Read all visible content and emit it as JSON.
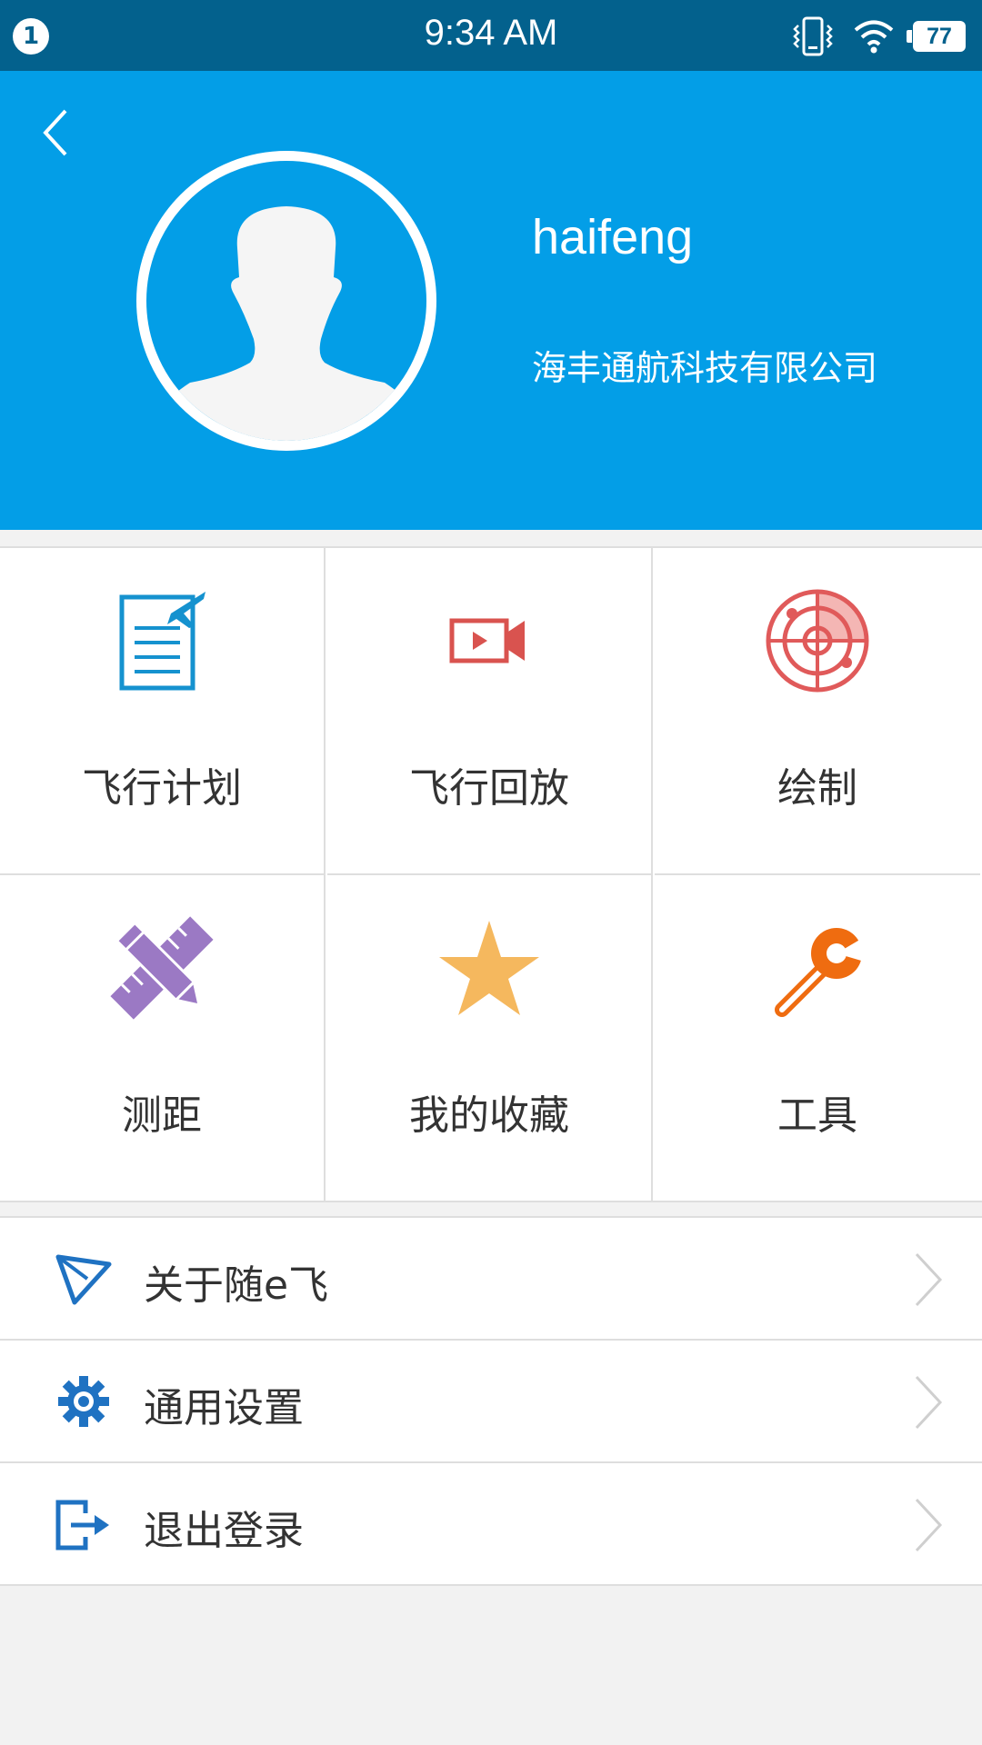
{
  "status_bar": {
    "notification_count": "1",
    "time": "9:34 AM",
    "battery": "77",
    "icons": [
      "vibrate-icon",
      "wifi-icon",
      "battery-icon"
    ]
  },
  "header": {
    "background_color": "#039ee7",
    "back_icon": "chevron-left-icon",
    "username": "haifeng",
    "company": "海丰通航科技有限公司"
  },
  "grid": {
    "items": [
      {
        "label": "飞行计划",
        "icon": "flight-plan-icon",
        "color": "#1592cf"
      },
      {
        "label": "飞行回放",
        "icon": "video-replay-icon",
        "color": "#d9534f"
      },
      {
        "label": "绘制",
        "icon": "radar-icon",
        "color": "#e05a5a"
      },
      {
        "label": "测距",
        "icon": "ruler-pencil-icon",
        "color": "#9b79c4"
      },
      {
        "label": "我的收藏",
        "icon": "star-icon",
        "color": "#f5b85e"
      },
      {
        "label": "工具",
        "icon": "wrench-icon",
        "color": "#ef6c10"
      }
    ]
  },
  "menu": {
    "items": [
      {
        "label": "关于随e飞",
        "icon": "paper-plane-icon"
      },
      {
        "label": "通用设置",
        "icon": "gear-icon"
      },
      {
        "label": "退出登录",
        "icon": "logout-icon"
      }
    ],
    "icon_color": "#1f72c2"
  }
}
